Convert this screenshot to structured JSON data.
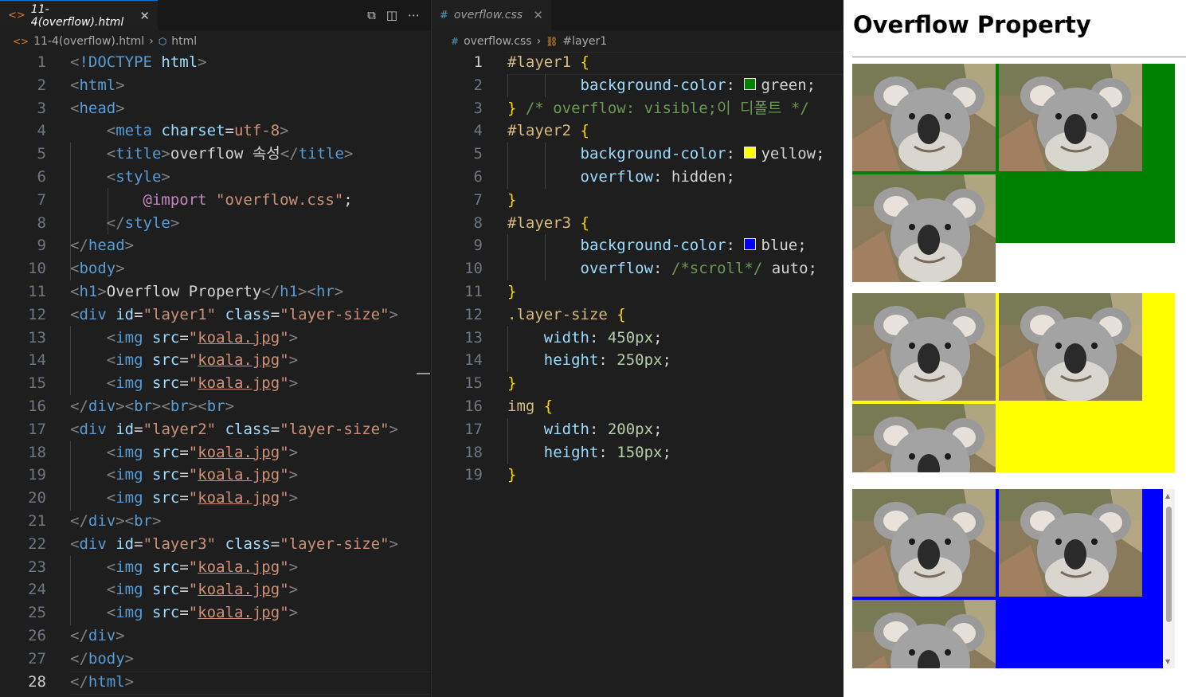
{
  "editor1": {
    "tab_label": "11-4(overflow).html",
    "tab_icon": "<>",
    "breadcrumb": [
      "11-4(overflow).html",
      "html"
    ],
    "current_line": 28,
    "lines": [
      "1",
      "2",
      "3",
      "4",
      "5",
      "6",
      "7",
      "8",
      "9",
      "10",
      "11",
      "12",
      "13",
      "14",
      "15",
      "16",
      "17",
      "18",
      "19",
      "20",
      "21",
      "22",
      "23",
      "24",
      "25",
      "26",
      "27",
      "28"
    ],
    "code": {
      "l1a": "<!DOCTYPE ",
      "l1b": "html",
      "l1c": ">",
      "lt": "<",
      "gt": ">",
      "lts": "</",
      "html": "html",
      "head": "head",
      "meta": "meta",
      "charset": "charset",
      "eq": "=",
      "utf8": "utf-8",
      "title": "title",
      "title_text": "overflow 속성",
      "style": "style",
      "import": "@import",
      "import_val": "\"overflow.css\"",
      "semi": ";",
      "body": "body",
      "h1": "h1",
      "h1_text": "Overflow Property",
      "hr": "hr",
      "div": "div",
      "id": "id",
      "class": "class",
      "q": "\"",
      "layer1": "layer1",
      "layer2": "layer2",
      "layer3": "layer3",
      "layer_size": "layer-size",
      "img": "img",
      "src": "src",
      "koala": "koala.jpg",
      "br": "br"
    }
  },
  "editor2": {
    "tab_label": "overflow.css",
    "tab_icon": "#",
    "breadcrumb": [
      "overflow.css",
      "#layer1"
    ],
    "current_line": 1,
    "code": {
      "sel1": "#layer1",
      "sel2": "#layer2",
      "sel3": "#layer3",
      "sel4": ".layer-size",
      "sel5": "img",
      "ob": "{",
      "cb": "}",
      "bg": "background-color",
      "ov": "overflow",
      "w": "width",
      "h": "height",
      "green": "green;",
      "yellow": "yellow;",
      "blue": "blue;",
      "hidden": "hidden;",
      "auto": "auto;",
      "scroll_cm": "/*scroll*/",
      "comment1": "/* overflow: visible;이 디폴트 */",
      "w450": "450px",
      "h250": "250px",
      "w200": "200px",
      "h150": "150px"
    },
    "colors": {
      "green": "#008000",
      "yellow": "#ffff00",
      "blue": "#0000ff"
    }
  },
  "browser": {
    "heading": "Overflow Property",
    "layers": [
      {
        "id": "layer1",
        "bg": "#008000",
        "overflow": "visible"
      },
      {
        "id": "layer2",
        "bg": "#ffff00",
        "overflow": "hidden"
      },
      {
        "id": "layer3",
        "bg": "#0000ff",
        "overflow": "auto"
      }
    ]
  }
}
